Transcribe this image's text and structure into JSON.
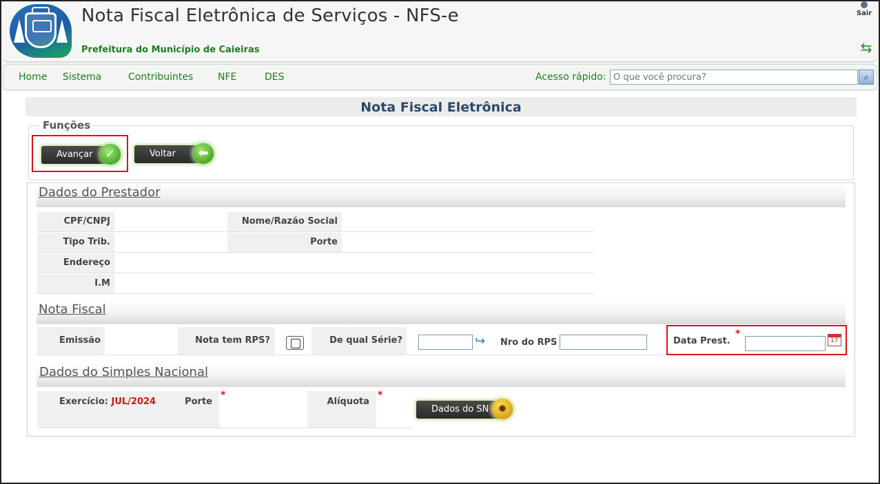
{
  "header": {
    "title": "Nota Fiscal Eletrônica de Serviços - NFS-e",
    "subtitle": "Prefeitura do Município de Caieiras",
    "sair_label": "Sair"
  },
  "nav": {
    "items": [
      "Home",
      "Sistema",
      "Contribuintes",
      "NFE",
      "DES"
    ],
    "quick_label": "Acesso rápido:",
    "quick_placeholder": "O que você procura?"
  },
  "page": {
    "title": "Nota Fiscal Eletrônica"
  },
  "funcoes": {
    "legend": "Funções",
    "avancar": "Avançar",
    "voltar": "Voltar"
  },
  "prestador": {
    "title": "Dados do Prestador",
    "cpf_label": "CPF/CNPJ",
    "nome_label": "Nome/Razão Social",
    "tipo_label": "Tipo Trib.",
    "porte_label": "Porte",
    "endereco_label": "Endereço",
    "im_label": "I.M"
  },
  "nota": {
    "title": "Nota Fiscal",
    "emissao_label": "Emissão",
    "rps_label": "Nota tem RPS?",
    "serie_label": "De qual Série?",
    "nro_label": "Nro do RPS",
    "data_label": "Data Prest."
  },
  "simples": {
    "title": "Dados do Simples Nacional",
    "exercicio_label": "Exercício:",
    "exercicio_value": "JUL/2024",
    "porte_label": "Porte",
    "aliquota_label": "Alíquota",
    "dados_sn": "Dados do SN"
  },
  "colors": {
    "nav_text": "#1e7d1e",
    "highlight": "#dd1111",
    "title_blue": "#2a4a6a"
  }
}
